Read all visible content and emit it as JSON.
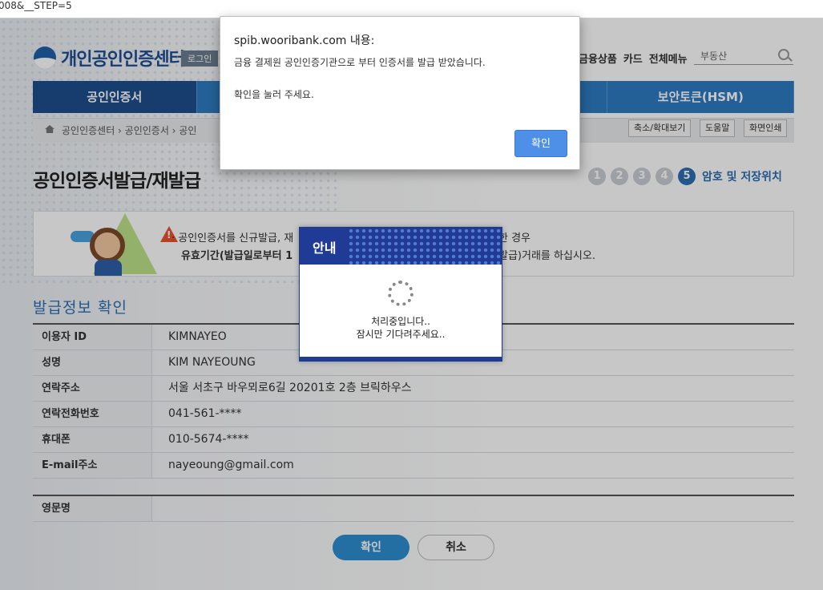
{
  "browser": {
    "url_fragment": "008&__STEP=5"
  },
  "header": {
    "logo_text": "개인공인인증센터",
    "login_chip": "로그인",
    "top_menu": [
      "금융상품",
      "카드",
      "전체메뉴"
    ],
    "search_value": "부동산"
  },
  "gnb": {
    "items": [
      "공인인증서",
      "",
      "",
      "보안토큰(HSM)"
    ]
  },
  "breadcrumb": {
    "path": "공인인증센터 › 공인인증서 › 공인",
    "buttons": [
      "축소/확대보기",
      "도움말",
      "화면인쇄"
    ]
  },
  "page": {
    "title": "공인인증서발급/재발급",
    "steps": [
      "1",
      "2",
      "3",
      "4",
      "5"
    ],
    "current_step": "5",
    "current_step_label": "암호 및 저장위치"
  },
  "notice": {
    "line1_left": "· 공인인증서를 신규발급, 재",
    "line2_left": "유효기간(발급일로부터 1",
    "line1_right": "한 경우",
    "line2_right": "발급)거래를 하십시오."
  },
  "info": {
    "section_title": "발급정보 확인",
    "rows": [
      {
        "label": "이용자 ID",
        "value": "KIMNAYEO"
      },
      {
        "label": "성명",
        "value": "KIM NAYEOUNG"
      },
      {
        "label": "연락주소",
        "value": "서울 서초구 바우뫼로6길 20201호 2층 브릭하우스"
      },
      {
        "label": "연락전화번호",
        "value": "041-561-****"
      },
      {
        "label": "휴대폰",
        "value": "010-5674-****"
      },
      {
        "label": "E-mail주소",
        "value": "nayeoung@gmail.com"
      }
    ],
    "english_name_label": "영문명",
    "english_name_value": ""
  },
  "actions": {
    "ok": "확인",
    "cancel": "취소"
  },
  "loading_modal": {
    "title": "안내",
    "line1": "처리중입니다..",
    "line2": "잠시만 기다려주세요.."
  },
  "alert": {
    "origin": "spib.wooribank.com 내용:",
    "message1": "금융 결제원 공인인증기관으로 부터 인증서를 발급 받았습니다.",
    "message2": "확인을 눌러 주세요.",
    "ok_button": "확인"
  },
  "colors": {
    "primary_blue": "#2d7cc2",
    "dark_blue": "#1f3b95",
    "alert_button": "#4e8fe7"
  }
}
